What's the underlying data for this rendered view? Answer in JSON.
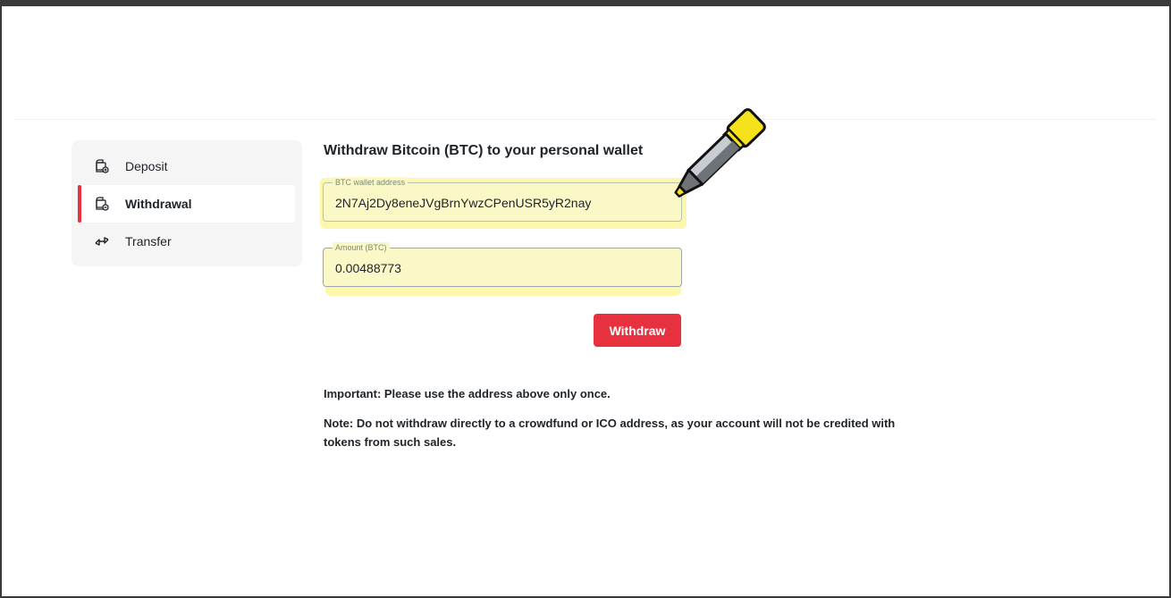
{
  "sidebar": {
    "items": [
      {
        "label": "Deposit",
        "icon": "wallet-icon",
        "active": false
      },
      {
        "label": "Withdrawal",
        "icon": "wallet-icon",
        "active": true
      },
      {
        "label": "Transfer",
        "icon": "transfer-arrows-icon",
        "active": false
      }
    ]
  },
  "main": {
    "title": "Withdraw Bitcoin (BTC) to your personal wallet",
    "address_field": {
      "label": "BTC wallet address",
      "value": "2N7Aj2Dy8eneJVgBrnYwzCPenUSR5yR2nay"
    },
    "amount_field": {
      "label": "Amount (BTC)",
      "value": "0.00488773"
    },
    "withdraw_button": "Withdraw",
    "important_note": "Important: Please use the address above only once.",
    "warning_note": "Note: Do not withdraw directly to a crowdfund or ICO address, as your account will not be credited with tokens from such sales."
  },
  "colors": {
    "accent": "#e8313f",
    "highlight": "#fdf6a0",
    "sidebar_bg": "#f5f5f5",
    "marker_yellow": "#f5e21a"
  },
  "decorations": {
    "overlay_icon": "highlighter-pen-icon"
  }
}
